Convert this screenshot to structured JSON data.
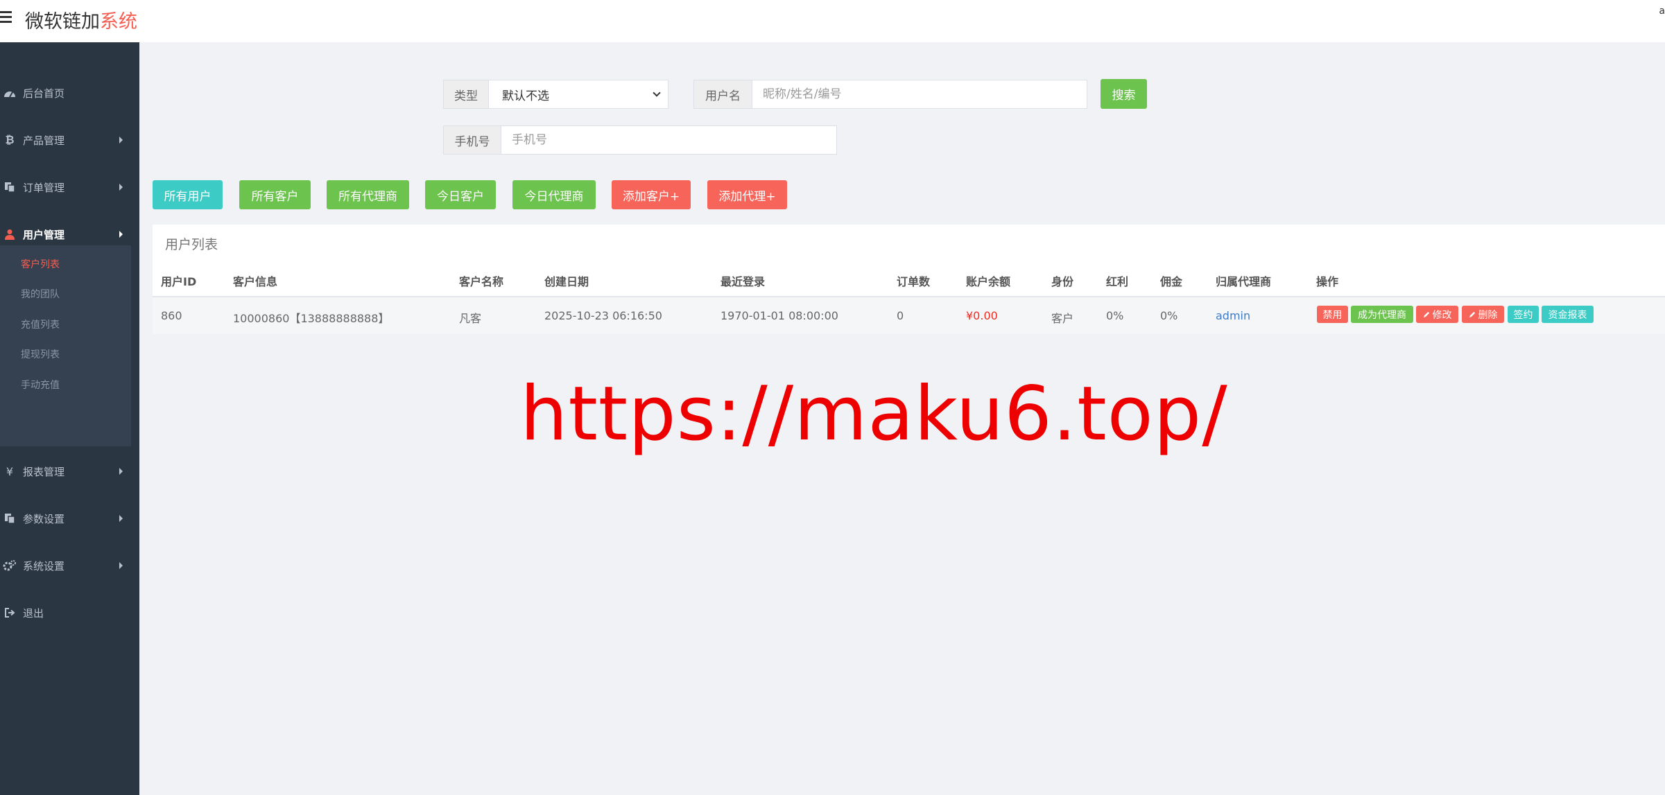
{
  "app": {
    "brand_main": "微软链加",
    "brand_accent": "系统",
    "user_initial": "a"
  },
  "colors": {
    "sidebar_bg": "#2b3643",
    "accent": "#f45e51",
    "teal": "#3ccbc5",
    "green": "#6cc44e",
    "red": "#f7645a",
    "money": "#f22b21",
    "watermark": "#ee0000"
  },
  "sidebar": {
    "items": [
      {
        "label": "后台首页",
        "icon": "dashboard-icon"
      },
      {
        "label": "产品管理",
        "icon": "bitcoin-icon"
      },
      {
        "label": "订单管理",
        "icon": "files-icon"
      },
      {
        "label": "用户管理",
        "icon": "user-icon"
      },
      {
        "label": "报表管理",
        "icon": "yen-icon"
      },
      {
        "label": "参数设置",
        "icon": "files-icon"
      },
      {
        "label": "系统设置",
        "icon": "gears-icon"
      },
      {
        "label": "退出",
        "icon": "sign-out-icon"
      }
    ],
    "sub_items": [
      "客户列表",
      "我的团队",
      "充值列表",
      "提现列表",
      "手动充值"
    ]
  },
  "filters": {
    "type_label": "类型",
    "type_value": "默认不选",
    "username_label": "用户名",
    "username_placeholder": "昵称/姓名/编号",
    "phone_label": "手机号",
    "phone_placeholder": "手机号",
    "search_label": "搜索"
  },
  "quick_buttons": [
    "所有用户",
    "所有客户",
    "所有代理商",
    "今日客户",
    "今日代理商",
    "添加客户+",
    "添加代理+"
  ],
  "table": {
    "title": "用户列表",
    "columns": [
      "用户ID",
      "客户信息",
      "客户名称",
      "创建日期",
      "最近登录",
      "订单数",
      "账户余额",
      "身份",
      "红利",
      "佣金",
      "归属代理商",
      "操作"
    ],
    "rows": [
      {
        "id": "860",
        "info": "10000860【13888888888】",
        "name": "凡客",
        "created": "2025-10-23 06:16:50",
        "last_login": "1970-01-01 08:00:00",
        "orders": "0",
        "balance": "¥0.00",
        "role": "客户",
        "bonus": "0%",
        "commission": "0%",
        "agent": "admin",
        "actions": [
          "禁用",
          "成为代理商",
          "修改",
          "删除",
          "签约",
          "资金报表"
        ]
      }
    ]
  },
  "watermark": "https://maku6.top/"
}
